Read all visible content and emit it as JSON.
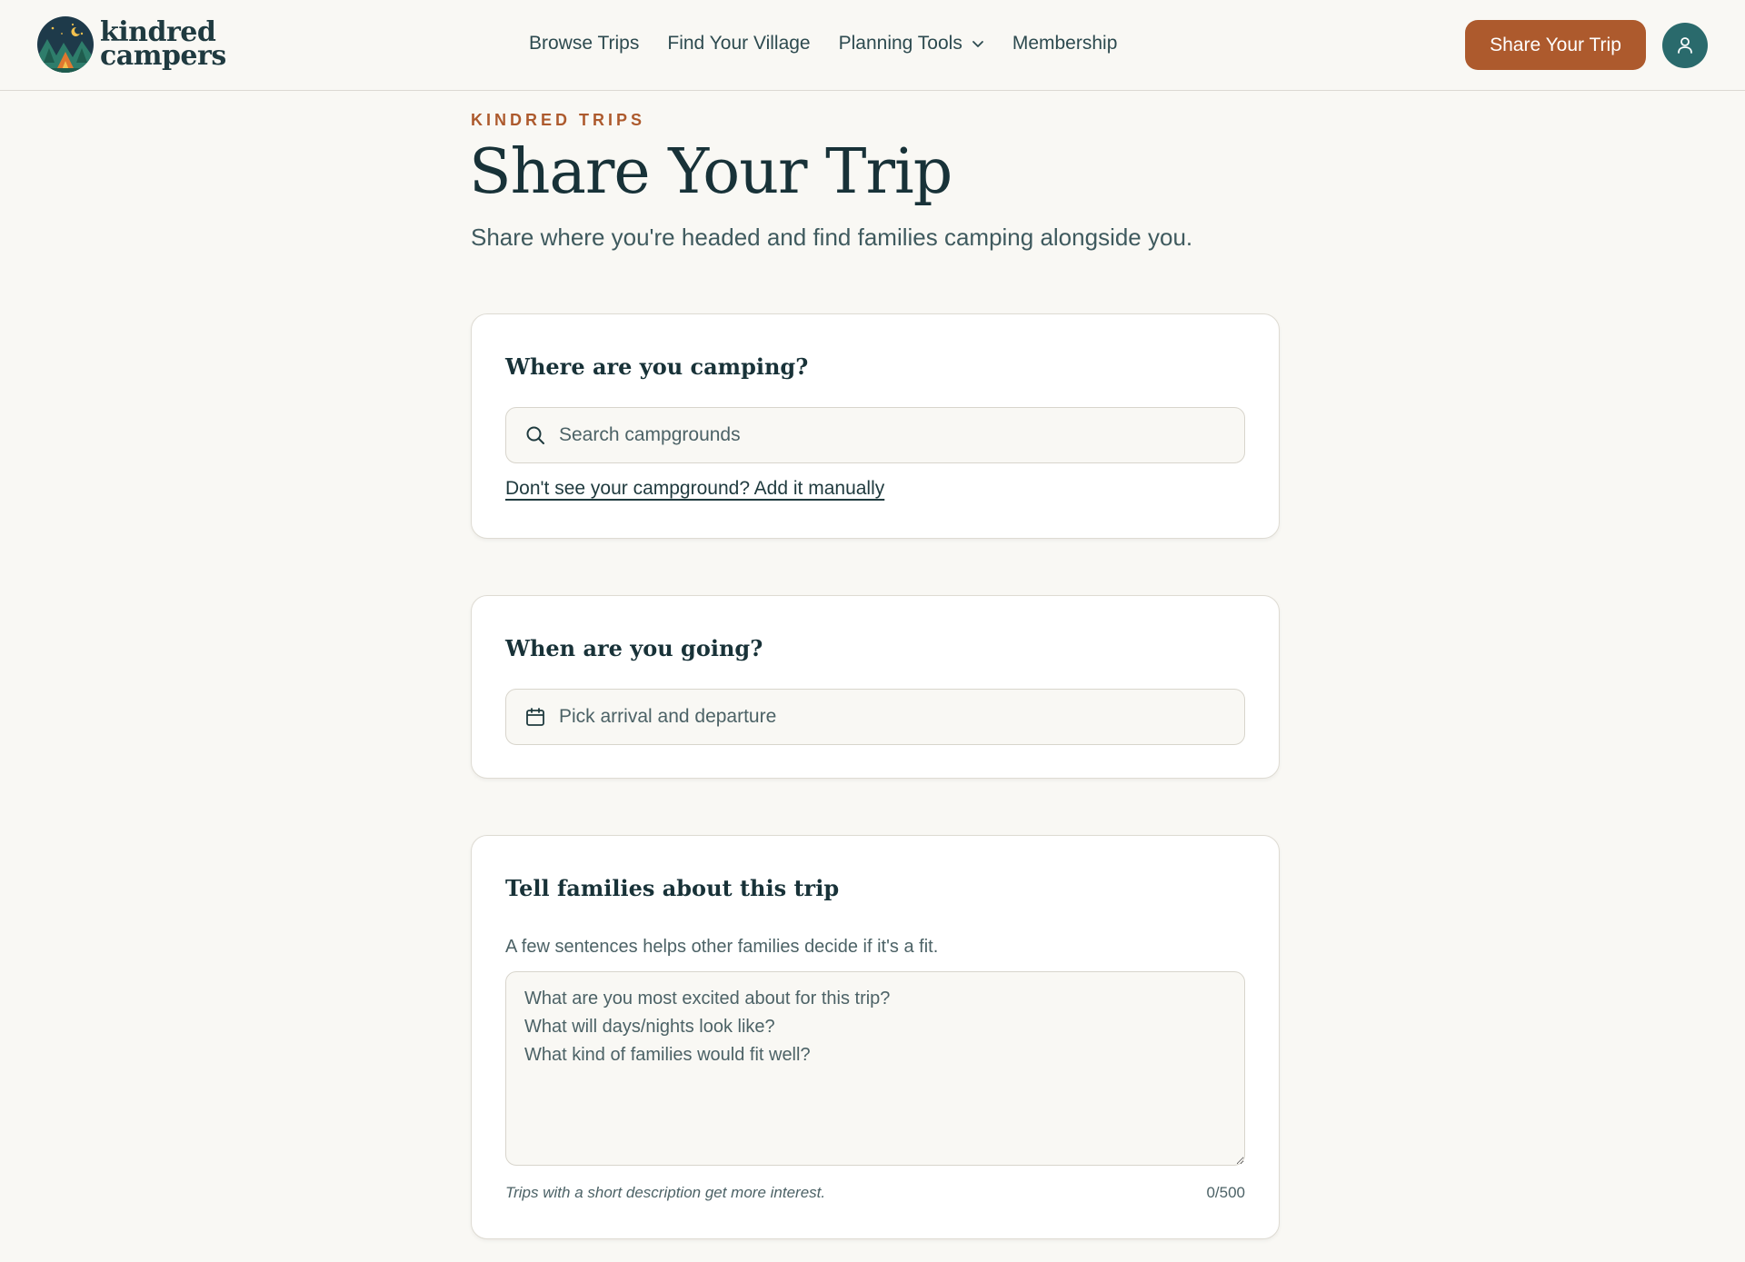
{
  "header": {
    "logo": {
      "line1": "kindred",
      "line2": "campers",
      "icon": "campsite-badge-icon"
    },
    "nav": [
      {
        "label": "Browse Trips"
      },
      {
        "label": "Find Your Village"
      },
      {
        "label": "Planning Tools",
        "icon": "chevron-down-icon"
      },
      {
        "label": "Membership"
      }
    ],
    "share_button": "Share Your Trip",
    "avatar_icon": "user-icon"
  },
  "page": {
    "eyebrow": "KINDRED TRIPS",
    "title": "Share Your Trip",
    "subtitle": "Share where you're headed and find families camping alongside you."
  },
  "location": {
    "heading": "Where are you camping?",
    "search_placeholder": "Search campgrounds",
    "search_icon": "search-icon",
    "manual_link": "Don't see your campground? Add it manually"
  },
  "dates": {
    "heading": "When are you going?",
    "placeholder": "Pick arrival and departure",
    "icon": "calendar-icon"
  },
  "description": {
    "heading": "Tell families about this trip",
    "help": "A few sentences helps other families decide if it's a fit.",
    "placeholder": "What are you most excited about for this trip?\nWhat will days/nights look like?\nWhat kind of families would fit well?",
    "value": "",
    "note": "Trips with a short description get more interest.",
    "counter": "0/500"
  },
  "colors": {
    "accent": "#ad5a2d",
    "avatar": "#2a6a6c",
    "background": "#f9f8f4",
    "text": "#183238"
  }
}
